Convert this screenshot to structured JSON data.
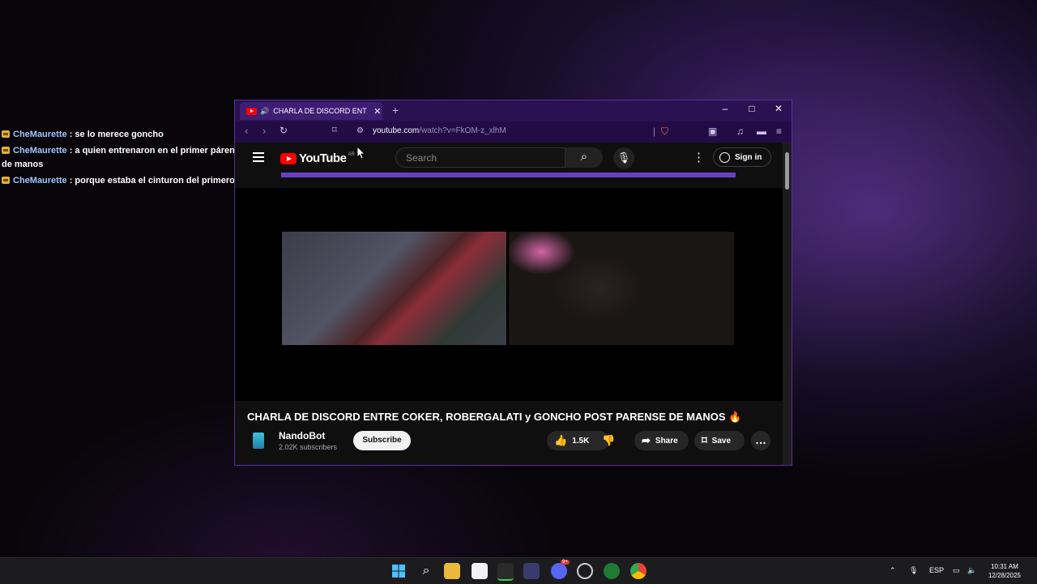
{
  "chat": [
    {
      "user": "CheMaurette",
      "text": ": se lo merece goncho"
    },
    {
      "user": "CheMaurette",
      "text": ": a quien entrenaron en el primer párense de manos"
    },
    {
      "user": "CheMaurette",
      "text": ": porque estaba el cinturon del primero"
    }
  ],
  "browser": {
    "tab_title": "CHARLA DE DISCORD ENTRE",
    "new_tab": "+",
    "url_host": "youtube.com",
    "url_path": "/watch?v=FkOM-z_xlhM",
    "minimize": "–",
    "maximize": "□",
    "close": "✕"
  },
  "youtube": {
    "logo_text": "YouTube",
    "country": "AR",
    "search_placeholder": "Search",
    "sign_in": "Sign in",
    "video_title": "CHARLA DE DISCORD ENTRE COKER, ROBERGALATI y GONCHO POST PARENSE DE MANOS 🔥",
    "channel_name": "NandoBot",
    "subscribers": "2.02K subscribers",
    "subscribe_label": "Subscribe",
    "likes": "1.5K",
    "share_label": "Share",
    "save_label": "Save"
  },
  "taskbar": {
    "lang": "ESP",
    "time": "10:31 AM",
    "date": "12/28/2025",
    "discord_badge": "9+"
  },
  "colors": {
    "tabbar": "#2a1152",
    "addressbar": "#230c46",
    "youtube_bg": "#0f0f0f",
    "youtube_red": "#ff0000",
    "chat_username": "#9ec6ff"
  }
}
